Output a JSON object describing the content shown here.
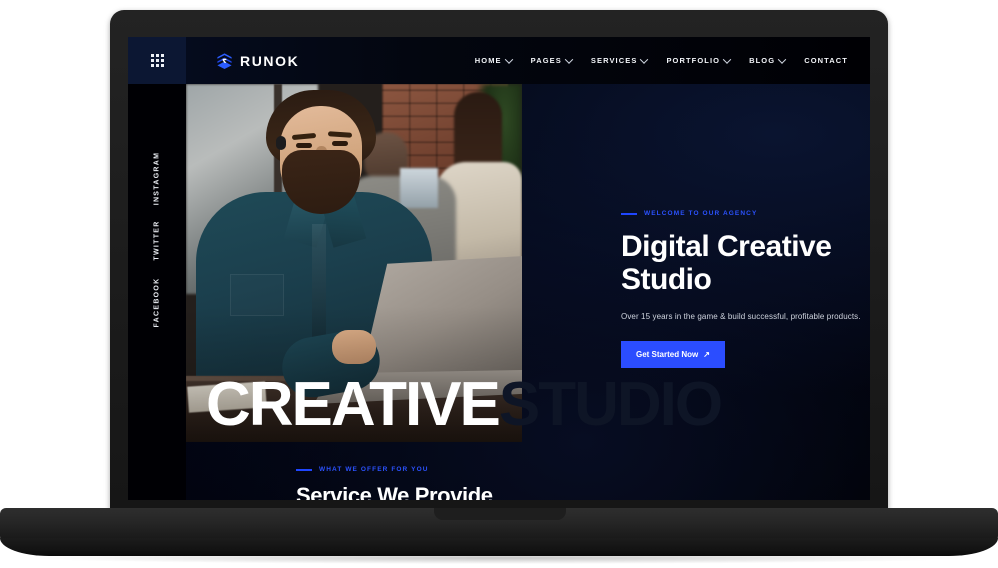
{
  "device": {
    "type": "laptop-mockup"
  },
  "site": {
    "header": {
      "grid_icon": "grid-menu-icon",
      "brand_icon": "runok-logo-icon",
      "brand_name": "RUNOK",
      "nav": [
        {
          "label": "HOME",
          "has_dropdown": true
        },
        {
          "label": "PAGES",
          "has_dropdown": true
        },
        {
          "label": "SERVICES",
          "has_dropdown": true
        },
        {
          "label": "PORTFOLIO",
          "has_dropdown": true
        },
        {
          "label": "BLOG",
          "has_dropdown": true
        },
        {
          "label": "CONTACT",
          "has_dropdown": false
        }
      ]
    },
    "social_rail": [
      {
        "label": "INSTAGRAM"
      },
      {
        "label": "TWITTER"
      },
      {
        "label": "FACEBOOK"
      }
    ],
    "hero": {
      "eyebrow": "WELCOME TO OUR AGENCY",
      "title": "Digital Creative\nStudio",
      "subtitle": "Over 15 years in the game & build successful, profitable products.",
      "cta_label": "Get Started Now",
      "cta_arrow": "↗",
      "photo_alt": "bearded-man-working-on-laptop-in-cafe",
      "big_word_front": "CREATIVE",
      "big_word_back": "STUDIO"
    },
    "services": {
      "eyebrow": "WHAT WE OFFER FOR YOU",
      "title": "Service We Provide"
    },
    "colors": {
      "accent_blue": "#2b4dff",
      "eyebrow_blue": "#2b52ff",
      "page_background": "#000005",
      "header_panel": "#0c1733",
      "ghost_text": "#0e1526",
      "text_light": "#ffffff",
      "text_muted": "#cfd4de",
      "device_body": "#262626"
    }
  }
}
